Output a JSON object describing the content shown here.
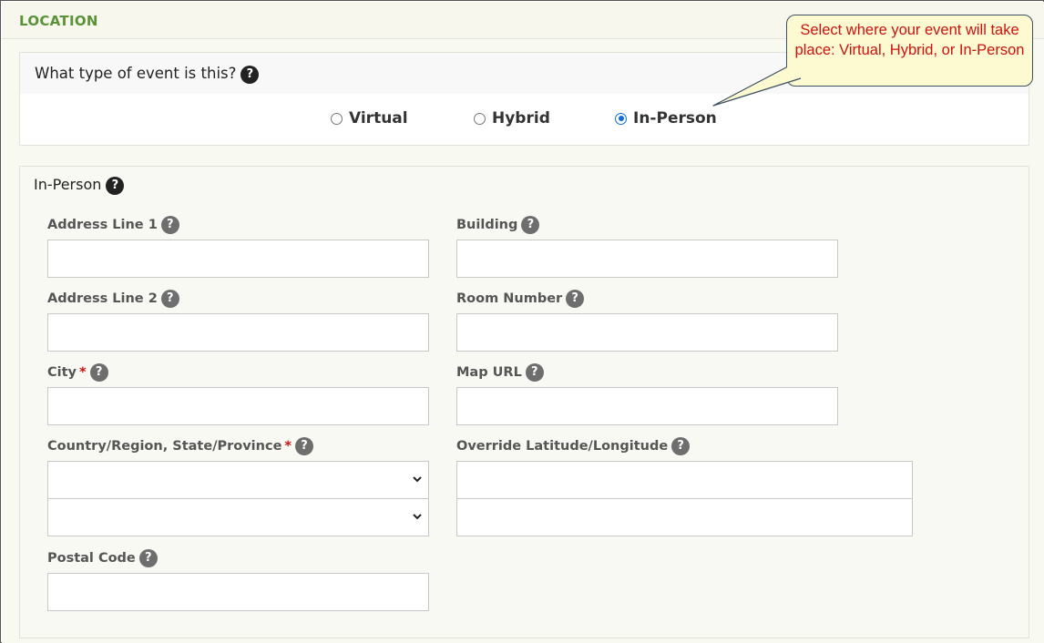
{
  "header": {
    "title": "LOCATION"
  },
  "event_type": {
    "question": "What type of event is this?",
    "help_icon": "?",
    "options": [
      {
        "label": "Virtual",
        "selected": false
      },
      {
        "label": "Hybrid",
        "selected": false
      },
      {
        "label": "In-Person",
        "selected": true
      }
    ]
  },
  "callout": {
    "text": "Select where your event will take place: Virtual, Hybrid, or In-Person"
  },
  "in_person": {
    "title": "In-Person",
    "help_icon": "?",
    "fields": {
      "address_line_1": {
        "label": "Address Line 1",
        "value": "",
        "help": "?"
      },
      "address_line_2": {
        "label": "Address Line 2",
        "value": "",
        "help": "?"
      },
      "city": {
        "label": "City",
        "required_mark": "*",
        "value": "",
        "help": "?"
      },
      "country_state": {
        "label": "Country/Region, State/Province",
        "required_mark": "*",
        "country_value": "",
        "state_value": "",
        "help": "?"
      },
      "postal_code": {
        "label": "Postal Code",
        "value": "",
        "help": "?"
      },
      "building": {
        "label": "Building",
        "value": "",
        "help": "?"
      },
      "room_number": {
        "label": "Room Number",
        "value": "",
        "help": "?"
      },
      "map_url": {
        "label": "Map URL",
        "value": "",
        "help": "?"
      },
      "override_lat_long": {
        "label": "Override Latitude/Longitude",
        "latitude_value": "",
        "longitude_value": "",
        "help": "?"
      }
    }
  },
  "colors": {
    "header_text": "#5a9238",
    "required": "#cc1111",
    "radio_selected": "#0f6fd6",
    "callout_text": "#cc1212",
    "callout_bg": "#fdf9d0"
  }
}
